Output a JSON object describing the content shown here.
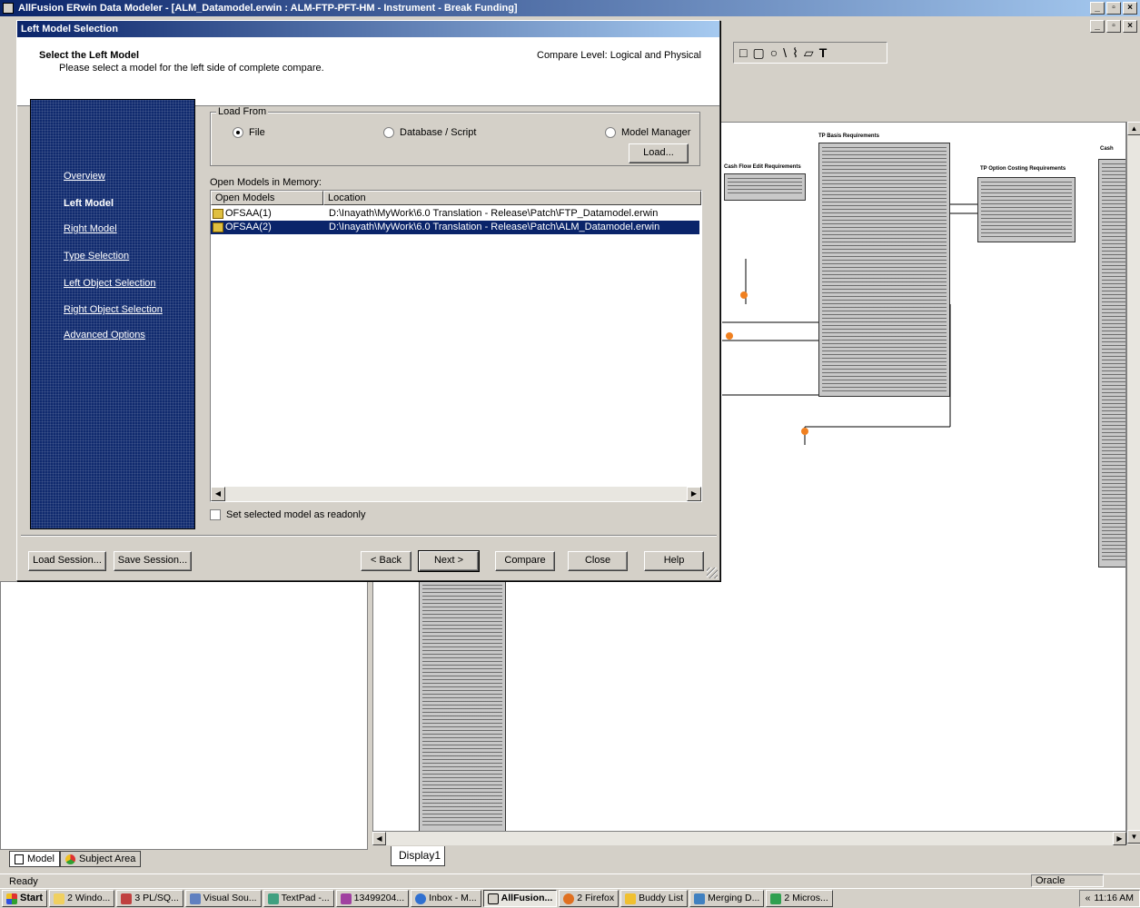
{
  "app": {
    "title": "AllFusion ERwin Data Modeler - [ALM_Datamodel.erwin : ALM-FTP-PFT-HM - Instrument - Break Funding]",
    "status_text": "Ready",
    "status_db": "Oracle",
    "diagram_tab": "Display1",
    "model_tabs": [
      "Model",
      "Subject Area"
    ],
    "entities": [
      {
        "title": "TP Basis Requirements"
      },
      {
        "title": "Cash Flow Edit Requirements"
      },
      {
        "title": "TP Option Costing Requirements"
      },
      {
        "title": "Cash"
      }
    ]
  },
  "dialog": {
    "title": "Left Model Selection",
    "header_title": "Select the Left Model",
    "header_subtitle": "Please select a model for the left side of complete compare.",
    "compare_level": "Compare Level: Logical and Physical",
    "nav": [
      {
        "label": "Overview",
        "active": false
      },
      {
        "label": "Left Model",
        "active": true
      },
      {
        "label": "Right Model",
        "active": false
      },
      {
        "label": "Type Selection",
        "active": false
      },
      {
        "label": "Left Object Selection",
        "active": false
      },
      {
        "label": "Right Object Selection",
        "active": false
      },
      {
        "label": "Advanced Options",
        "active": false
      }
    ],
    "load_from": {
      "legend": "Load From",
      "options": [
        "File",
        "Database / Script",
        "Model Manager"
      ],
      "selected": "File",
      "load_button": "Load..."
    },
    "open_models_label": "Open Models in Memory:",
    "columns": [
      "Open Models",
      "Location"
    ],
    "rows": [
      {
        "name": "OFSAA(1)",
        "location": "D:\\Inayath\\MyWork\\6.0 Translation - Release\\Patch\\FTP_Datamodel.erwin",
        "selected": false
      },
      {
        "name": "OFSAA(2)",
        "location": "D:\\Inayath\\MyWork\\6.0 Translation - Release\\Patch\\ALM_Datamodel.erwin",
        "selected": true
      }
    ],
    "readonly_checkbox": "Set selected model as readonly",
    "buttons": {
      "load_session": "Load Session...",
      "save_session": "Save Session...",
      "back": "< Back",
      "next": "Next >",
      "compare": "Compare",
      "close": "Close",
      "help": "Help"
    }
  },
  "taskbar": {
    "start": "Start",
    "items": [
      "2 Windo...",
      "3 PL/SQ...",
      "Visual Sou...",
      "TextPad -...",
      "13499204...",
      "Inbox - M...",
      "AllFusion...",
      "2 Firefox",
      "Buddy List",
      "Merging D...",
      "2 Micros..."
    ],
    "active": "AllFusion...",
    "clock": "11:16 AM"
  },
  "colors": {
    "title_bar": "#0a246a",
    "nav_panel": "#102a6e",
    "selection": "#0a246a",
    "face": "#d4d0c8"
  }
}
